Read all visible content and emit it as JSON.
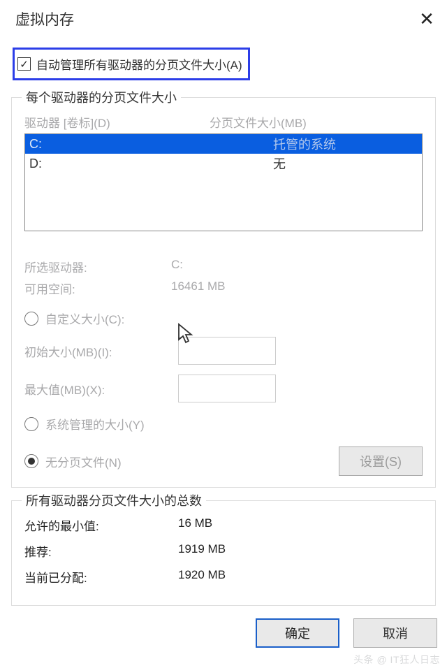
{
  "title": "虚拟内存",
  "auto_manage_label": "自动管理所有驱动器的分页文件大小(A)",
  "auto_manage_checked": true,
  "section1": {
    "legend": "每个驱动器的分页文件大小",
    "col_drive": "驱动器 [卷标](D)",
    "col_size": "分页文件大小(MB)",
    "rows": [
      {
        "drive": "C:",
        "size": "托管的系统",
        "selected": true
      },
      {
        "drive": "D:",
        "size": "无",
        "selected": false
      }
    ],
    "selected_drive_label": "所选驱动器:",
    "selected_drive_value": "C:",
    "freespace_label": "可用空间:",
    "freespace_value": "16461 MB",
    "radio_custom": "自定义大小(C):",
    "initial_label": "初始大小(MB)(I):",
    "max_label": "最大值(MB)(X):",
    "radio_system": "系统管理的大小(Y)",
    "radio_nofile": "无分页文件(N)",
    "set_button": "设置(S)"
  },
  "section2": {
    "legend": "所有驱动器分页文件大小的总数",
    "min_label": "允许的最小值:",
    "min_value": "16 MB",
    "rec_label": "推荐:",
    "rec_value": "1919 MB",
    "cur_label": "当前已分配:",
    "cur_value": "1920 MB"
  },
  "buttons": {
    "ok": "确定",
    "cancel": "取消"
  },
  "watermark": "头条 @ IT狂人日志"
}
